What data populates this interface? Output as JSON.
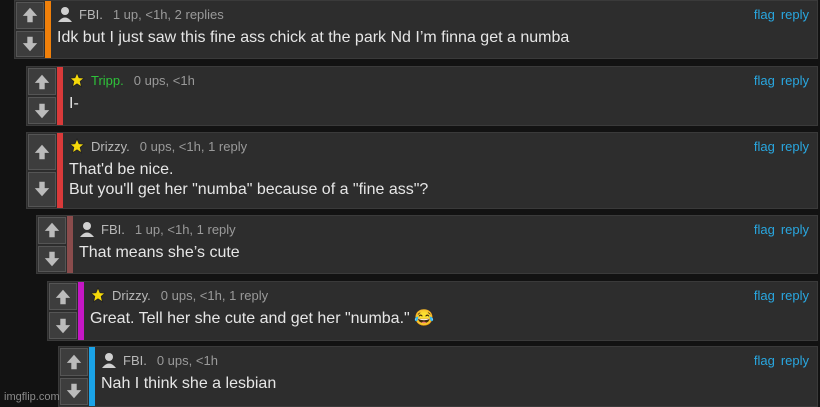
{
  "comments": [
    {
      "username": "FBI.",
      "user_icon": "user-icon",
      "meta": "1 up, <1h, 2 replies",
      "flag": "flag",
      "reply": "reply",
      "text": "Idk but I just saw this fine ass chick at the park Nd I’m finna get a numba",
      "accent": "#f0800a"
    },
    {
      "username": "Tripp.",
      "user_icon": "star-icon",
      "meta": "0 ups, <1h",
      "flag": "flag",
      "reply": "reply",
      "text": "I-",
      "accent": "#d93a3a",
      "username_color": "#2ec23a"
    },
    {
      "username": "Drizzy.",
      "user_icon": "star-icon",
      "meta": "0 ups, <1h, 1 reply",
      "flag": "flag",
      "reply": "reply",
      "text": "That'd be nice.\nBut you'll get her \"numba\" because of a \"fine ass\"?",
      "accent": "#d93a3a"
    },
    {
      "username": "FBI.",
      "user_icon": "user-icon",
      "meta": "1 up, <1h, 1 reply",
      "flag": "flag",
      "reply": "reply",
      "text": "That means she’s cute",
      "accent": "#8a4c4c"
    },
    {
      "username": "Drizzy.",
      "user_icon": "star-icon",
      "meta": "0 ups, <1h, 1 reply",
      "flag": "flag",
      "reply": "reply",
      "text": "Great. Tell her she cute and get her \"numba.\" 😂",
      "accent": "#c517c5"
    },
    {
      "username": "FBI.",
      "user_icon": "user-icon",
      "meta": "0 ups, <1h",
      "flag": "flag",
      "reply": "reply",
      "text": "Nah I think she a lesbian",
      "accent": "#1aa3e8"
    }
  ],
  "watermark": "imgflip.com"
}
